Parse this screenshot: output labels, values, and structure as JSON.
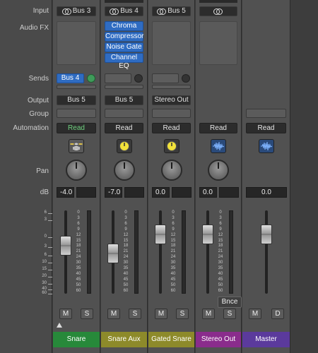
{
  "row_labels": {
    "input": "Input",
    "audio_fx": "Audio FX",
    "sends": "Sends",
    "output": "Output",
    "group": "Group",
    "automation": "Automation",
    "pan": "Pan",
    "db": "dB"
  },
  "scale_left": [
    "6",
    "3",
    "0",
    "3",
    "6",
    "10",
    "15",
    "20",
    "30",
    "40",
    "60"
  ],
  "scale_meter": [
    "0",
    "3",
    "6",
    "9",
    "12",
    "15",
    "18",
    "21",
    "24",
    "30",
    "35",
    "40",
    "45",
    "50",
    "60"
  ],
  "strips": [
    {
      "name": "Snare",
      "name_color": "#27893a",
      "input": "Bus 3",
      "fx": [],
      "send": "Bus 4",
      "output": "Bus 5",
      "automation": "Read",
      "automation_green": true,
      "icon": "drum-kit-icon",
      "db": "-4.0",
      "mute": "M",
      "solo": "S",
      "fader_level_db": -4.0
    },
    {
      "name": "Snare Aux",
      "name_color": "#8d8a2a",
      "input": "Bus 4",
      "fx": [
        "Chroma",
        "Compressor",
        "Noise Gate",
        "Channel EQ"
      ],
      "send": "",
      "output": "Bus 5",
      "automation": "Read",
      "automation_green": false,
      "icon": "compressor-icon",
      "db": "-7.0",
      "mute": "M",
      "solo": "S",
      "fader_level_db": -7.0
    },
    {
      "name": "Gated Snare",
      "name_color": "#8d8a2a",
      "input": "Bus 5",
      "fx": [],
      "send": "",
      "output": "Stereo Out",
      "automation": "Read",
      "automation_green": false,
      "icon": "compressor-icon",
      "db": "0.0",
      "mute": "M",
      "solo": "S",
      "fader_level_db": 0.0
    },
    {
      "name": "Stereo Out",
      "name_color": "#8a2c8c",
      "input": "",
      "fx": [],
      "send": "",
      "output": "",
      "automation": "Read",
      "automation_green": false,
      "icon": "waveform-icon",
      "db": "0.0",
      "mute": "M",
      "solo": "S",
      "fader_level_db": 0.0
    },
    {
      "name": "Master",
      "name_color": "#5b3a9c",
      "input": "",
      "fx": [],
      "send": "",
      "output": "",
      "automation": "Read",
      "automation_green": false,
      "icon": "waveform-icon",
      "db": "0.0",
      "mute": "M",
      "solo": "D",
      "fader_level_db": 0.0
    }
  ],
  "tooltip": "Bnce"
}
